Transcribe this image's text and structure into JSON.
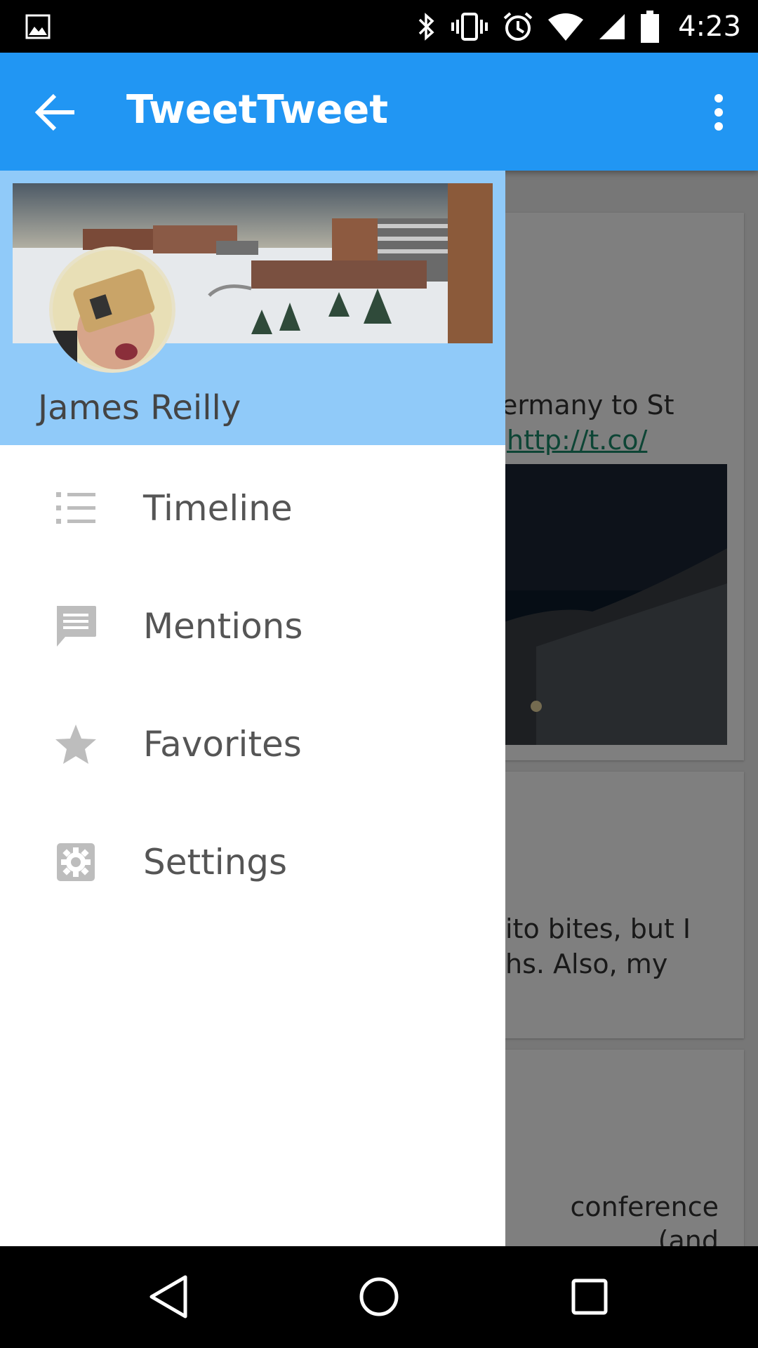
{
  "status_bar": {
    "time": "4:23"
  },
  "app_bar": {
    "title": "TweetTweet"
  },
  "drawer": {
    "user_name": "James Reilly",
    "items": [
      {
        "label": "Timeline",
        "icon": "list-icon"
      },
      {
        "label": "Mentions",
        "icon": "message-icon"
      },
      {
        "label": "Favorites",
        "icon": "star-icon"
      },
      {
        "label": "Settings",
        "icon": "gear-icon"
      }
    ]
  },
  "background_content": {
    "tweet_1_line_1": "ermany to St",
    "tweet_1_link": "http://t.co/",
    "tweet_2_line_1": "ito bites, but I",
    "tweet_2_line_2": "hs. Also, my",
    "tweet_3_line_1": "conference (and"
  },
  "colors": {
    "app_bar": "#2196f3",
    "drawer_header": "#90caf9",
    "link": "#1b8a6b"
  }
}
